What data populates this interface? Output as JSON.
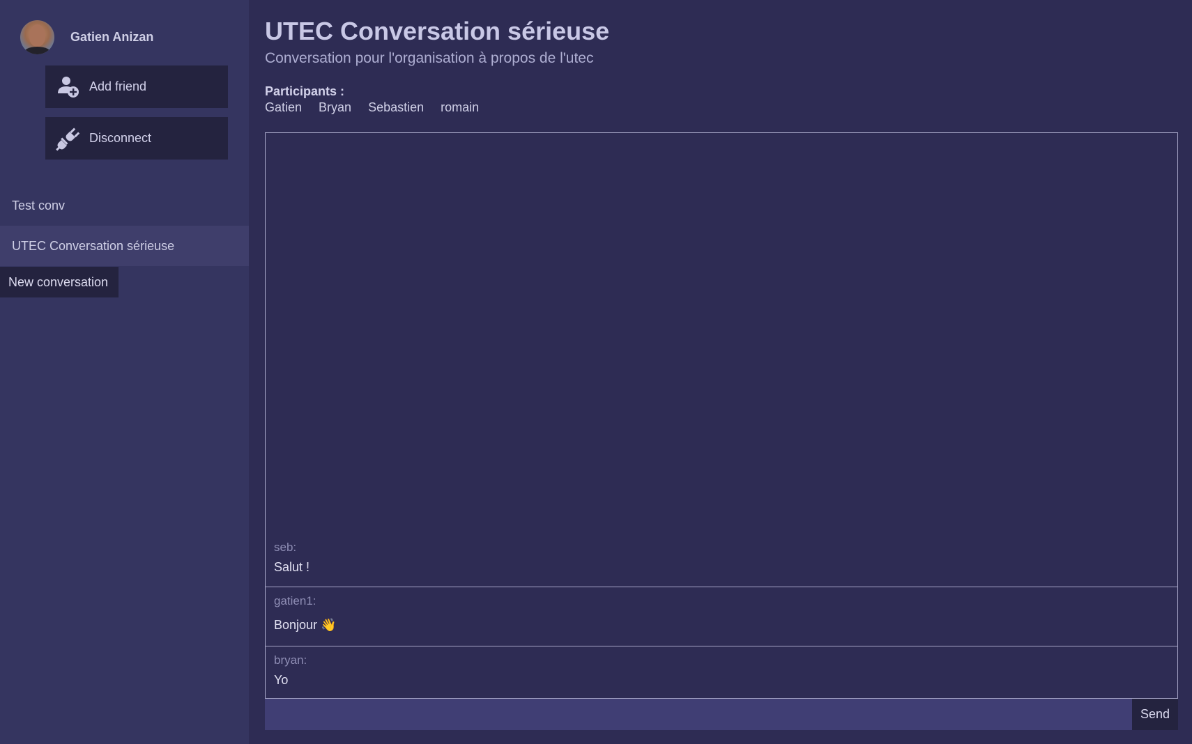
{
  "user": {
    "name": "Gatien Anizan",
    "avatar_icon": "user-avatar"
  },
  "sidebar": {
    "buttons": [
      {
        "label": "Add friend",
        "icon": "add-user-icon"
      },
      {
        "label": "Disconnect",
        "icon": "unplug-icon"
      }
    ],
    "conversations": [
      {
        "label": "Test conv",
        "active": false
      },
      {
        "label": "UTEC Conversation sérieuse",
        "active": true
      }
    ],
    "new_conversation_label": "New conversation"
  },
  "conversation": {
    "title": "UTEC Conversation sérieuse",
    "description": "Conversation pour l'organisation à propos de l'utec",
    "participants_label": "Participants :",
    "participants": [
      "Gatien",
      "Bryan",
      "Sebastien",
      "romain"
    ],
    "messages": [
      {
        "author": "seb:",
        "text": "Salut !"
      },
      {
        "author": "gatien1:",
        "text": "Bonjour 👋"
      },
      {
        "author": "bryan:",
        "text": "Yo"
      }
    ]
  },
  "composer": {
    "value": "",
    "send_label": "Send"
  },
  "colors": {
    "background": "#2e2c54",
    "sidebar": "#353560",
    "button_dark": "#24233f",
    "active_item": "#3f3e6b",
    "input": "#403e74"
  }
}
